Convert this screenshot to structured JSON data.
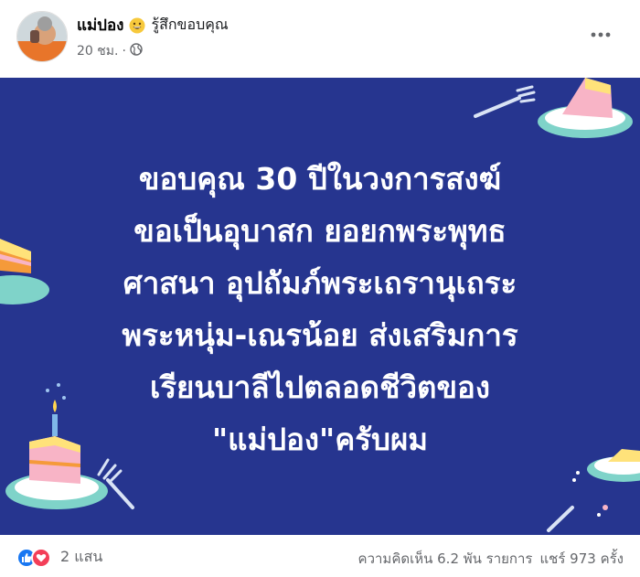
{
  "post": {
    "author": "แม่ปอง",
    "feeling": "รู้สึกขอบคุณ",
    "time": "20 ชม.",
    "dot": "·",
    "icons": {
      "emoji": "grinning-face-emoji",
      "privacy": "globe-icon",
      "more": "more-options-icon"
    },
    "image_text": [
      "ขอบคุณ 30 ปีในวงการสงฆ์",
      "ขอเป็นอุบาสก ยอยกพระพุทธ",
      "ศาสนา อุปถัมภ์พระเถรานุเถระ",
      "พระหนุ่ม-เณรน้อย ส่งเสริมการ",
      "เรียนบาลีไปตลอดชีวิตของ",
      "\"แม่ปอง\"ครับผม"
    ],
    "image_bg": "#26358f"
  },
  "footer": {
    "reactions_count": "2 แสน",
    "comments": "ความคิดเห็น 6.2 พัน รายการ",
    "shares": "แชร์ 973 ครั้ง",
    "like_color": "#1877f2",
    "love_color": "#f33e58"
  }
}
